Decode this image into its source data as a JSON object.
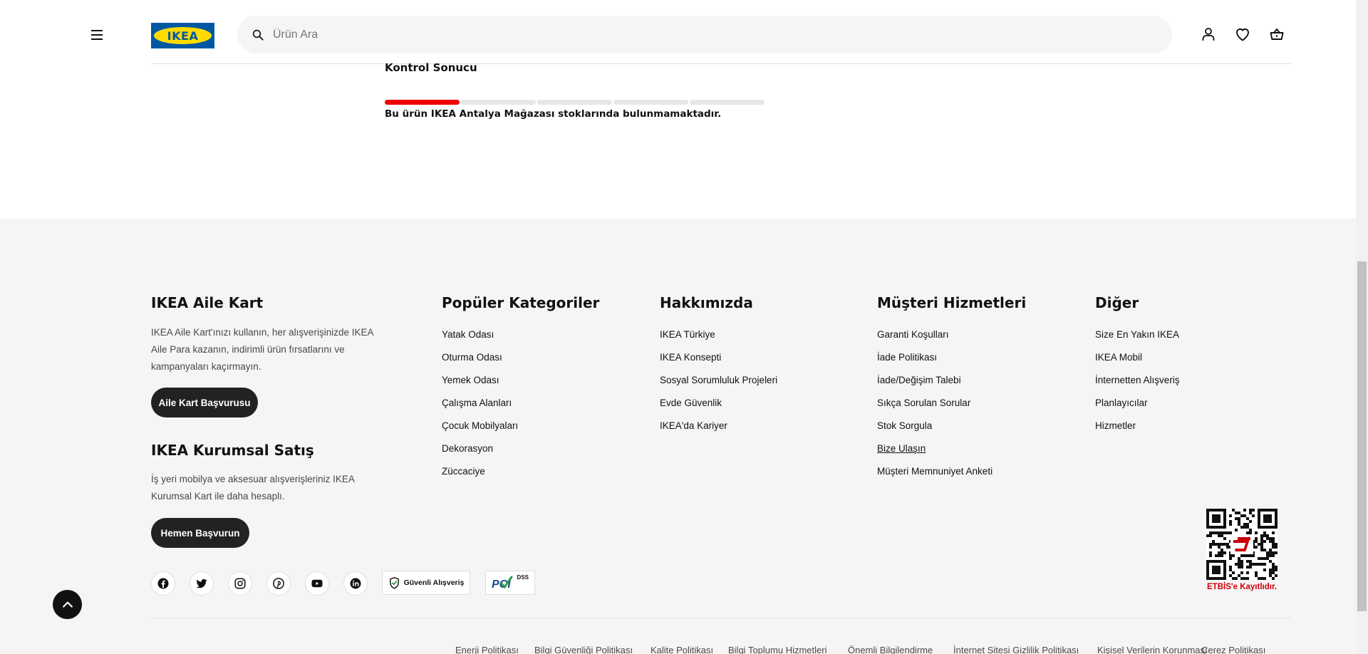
{
  "header": {
    "menu_icon": "hamburger-menu-icon",
    "logo_text": "IKEA",
    "search_placeholder": "Ürün Ara",
    "icons": [
      "user-icon",
      "heart-icon",
      "basket-icon"
    ]
  },
  "stock": {
    "title": "Kontrol Sonucu",
    "progress_segments": 5,
    "progress_filled": 1,
    "progress_color": "#f00000",
    "message": "Bu ürün IKEA Antalya Mağazası stoklarında bulunmamaktadır."
  },
  "footer": {
    "family_card": {
      "title": "IKEA Aile Kart",
      "text": "IKEA Aile Kart'ınızı kullanın, her alışverişinizde IKEA Aile Para kazanın, indirimli ürün fırsatlarını ve kampanyaları kaçırmayın.",
      "button": "Aile Kart Başvurusu"
    },
    "corporate": {
      "title": "IKEA Kurumsal Satış",
      "text": "İş yeri mobilya ve aksesuar alışverişleriniz IKEA Kurumsal Kart ile daha hesaplı.",
      "button": "Hemen Başvurun"
    },
    "columns": [
      {
        "title": "Popüler Kategoriler",
        "links": [
          "Yatak Odası",
          "Oturma Odası",
          "Yemek Odası",
          "Çalışma Alanları",
          "Çocuk Mobilyaları",
          "Dekorasyon",
          "Züccaciye"
        ]
      },
      {
        "title": "Hakkımızda",
        "links": [
          "IKEA Türkiye",
          "IKEA Konsepti",
          "Sosyal Sorumluluk Projeleri",
          "Evde Güvenlik",
          "IKEA'da Kariyer"
        ]
      },
      {
        "title": "Müşteri Hizmetleri",
        "links": [
          "Garanti Koşulları",
          "İade Politikası",
          "İade/Değişim Talebi",
          "Sıkça Sorulan Sorular",
          "Stok Sorgula",
          "Bize Ulaşın",
          "Müşteri Memnuniyet Anketi"
        ]
      },
      {
        "title": "Diğer",
        "links": [
          "Size En Yakın IKEA",
          "IKEA Mobil",
          "İnternetten Alışveriş",
          "Planlayıcılar",
          "Hizmetler"
        ]
      }
    ],
    "social": [
      "facebook-icon",
      "twitter-icon",
      "instagram-icon",
      "pinterest-icon",
      "youtube-icon",
      "linkedin-icon"
    ],
    "badges": {
      "secure": "Güvenli Alışveriş",
      "pci": "DSS"
    },
    "etbis": "ETBİS'e Kayıtlıdır.",
    "policies": [
      "Enerji Politikası",
      "Bilgi Güvenliği Politikası",
      "Kalite Politikası",
      "Bilgi Toplumu Hizmetleri",
      "Önemli Bilgilendirme",
      "İnternet Sitesi Gizlilik Politikası",
      "Kişisel Verilerin Korunması",
      "Çerez Politikası"
    ]
  },
  "colors": {
    "ikea_blue": "#0058a3",
    "ikea_yellow": "#ffdb00",
    "dark_button": "#222222",
    "etbis_red": "#cc0008"
  }
}
